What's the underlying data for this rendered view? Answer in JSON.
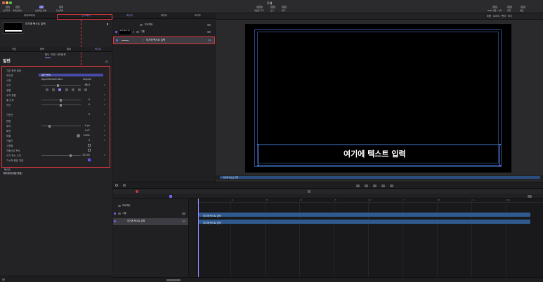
{
  "window": {
    "title": "무제",
    "toolbar_left": [
      {
        "label": "브라우저"
      },
      {
        "label": "라이브러리"
      },
      {
        "label": "프로젝트 패널"
      },
      {
        "label": "인스펙터"
      }
    ],
    "toolbar_center": [
      {
        "label": "새로운 추가"
      },
      {
        "label": "도구"
      },
      {
        "label": "렌더"
      }
    ],
    "toolbar_right": [
      {
        "label": "HUD 전용 / 시작"
      },
      {
        "label": "공유"
      },
      {
        "label": "배포"
      }
    ]
  },
  "left_tabs": [
    "라이브러리",
    "인스펙터"
  ],
  "preview": {
    "title": "여기에 텍스트 입력"
  },
  "inspector_tabs": [
    "속성",
    "동작",
    "필터",
    "텍스트"
  ],
  "inspector_subtabs": "형식 · 모양 · 레이아웃",
  "section_title": "일반",
  "general": {
    "preset_label": "기본 문체 설정",
    "rows": [
      {
        "label": "프리셋",
        "value": "일반 문체"
      },
      {
        "label": "서체",
        "value": "AppleSDGothicNeo",
        "extra": "Regular"
      },
      {
        "label": "크기",
        "value": "86.0"
      },
      {
        "label": "정렬",
        "value": ""
      },
      {
        "label": "수직 정렬",
        "value": ""
      },
      {
        "label": "줄 간격",
        "value": "0"
      },
      {
        "label": "자간",
        "value": "0"
      },
      {
        "label": "기준선",
        "value": "0"
      }
    ],
    "section2": "변형",
    "rows2": [
      {
        "label": "위치",
        "value": "0 px"
      },
      {
        "label": "회전",
        "value": "0.0°"
      },
      {
        "label": "비율",
        "value": "100%"
      },
      {
        "label": "기울기",
        "value": "0"
      },
      {
        "label": "고정점",
        "value": ""
      },
      {
        "label": "자동으로 축소",
        "value": ""
      },
      {
        "label": "크기 최소 수치",
        "value": "33.3%"
      },
      {
        "label": "가시적 응답 지점",
        "value": ""
      }
    ],
    "footer": [
      "텍스트",
      "텍스트의 최상 모습"
    ]
  },
  "layers_tabs": [
    "레이어",
    "미디어",
    "오디오"
  ],
  "layers": [
    {
      "name": "프로젝트",
      "indent": 0
    },
    {
      "name": "그룹",
      "indent": 1
    },
    {
      "name": "여기에 텍스트 입력",
      "indent": 2
    }
  ],
  "canvas": {
    "top_status": "조합 · 100% · 렌더 · 보기",
    "text": "여기에 텍스트 입력",
    "bottom_label": "여기에 텍스트 입력"
  },
  "timeline": {
    "tracks": [
      {
        "name": "프로젝트"
      },
      {
        "name": "그룹"
      },
      {
        "name": "여기에 텍스트 입력"
      }
    ],
    "bar1": "여기에 텍스트 입력",
    "bar2": "여기에 텍스트 입력",
    "ruler": [
      "1",
      "2",
      "3",
      "4",
      "5",
      "6",
      "7",
      "8",
      "9",
      "10"
    ]
  },
  "colors": {
    "accent": "#5a5af0",
    "highlight": "#e0373f",
    "track": "#2f5a8f"
  }
}
